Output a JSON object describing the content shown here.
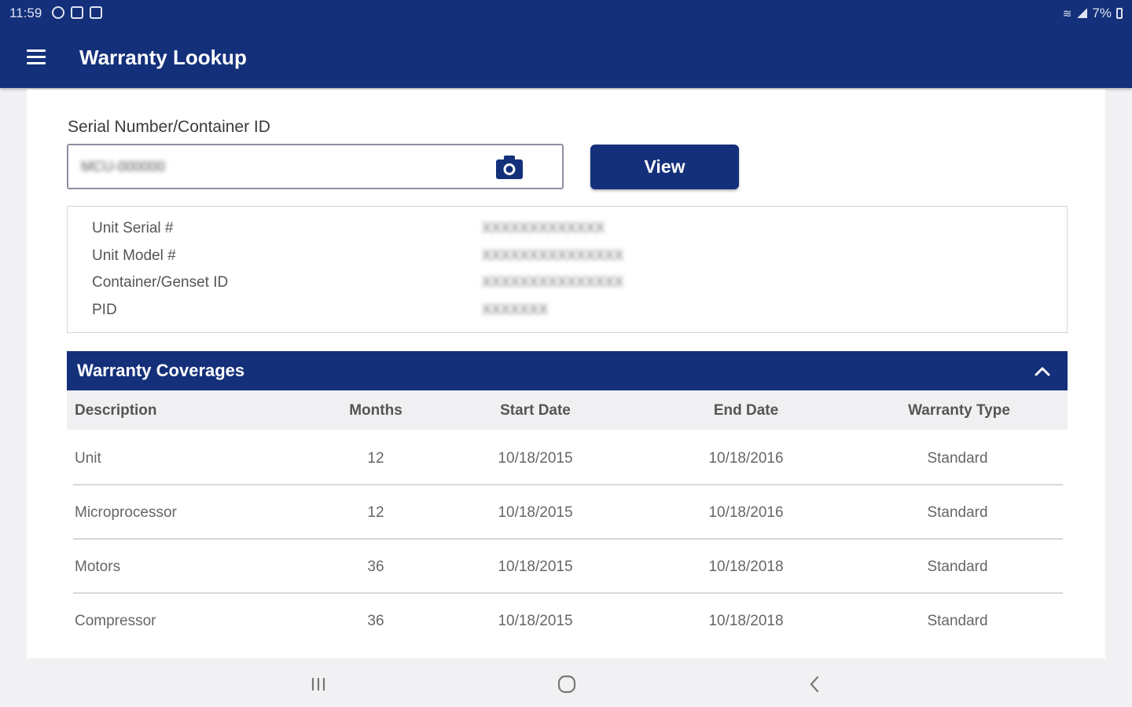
{
  "status_bar": {
    "time": "11:59",
    "battery": "7%",
    "icons": [
      "app-notification-icon",
      "image-icon",
      "calendar-icon",
      "wifi-icon",
      "signal-icon",
      "battery-icon"
    ]
  },
  "app_bar": {
    "title": "Warranty Lookup",
    "menu_icon": "hamburger-menu-icon"
  },
  "search": {
    "label": "Serial Number/Container ID",
    "value": "MCU-000000",
    "camera_icon": "camera-icon",
    "view_label": "View"
  },
  "unit_info": [
    {
      "label": "Unit Serial #",
      "value": "XXXXXXXXXXXXX"
    },
    {
      "label": "Unit Model #",
      "value": "XXXXXXXXXXXXXXX"
    },
    {
      "label": "Container/Genset ID",
      "value": "XXXXXXXXXXXXXXX"
    },
    {
      "label": "PID",
      "value": "XXXXXXX"
    }
  ],
  "coverages": {
    "title": "Warranty Coverages",
    "toggle_icon": "chevron-up-icon",
    "columns": [
      "Description",
      "Months",
      "Start Date",
      "End Date",
      "Warranty Type"
    ],
    "rows": [
      {
        "description": "Unit",
        "months": "12",
        "start": "10/18/2015",
        "end": "10/18/2016",
        "type": "Standard"
      },
      {
        "description": "Microprocessor",
        "months": "12",
        "start": "10/18/2015",
        "end": "10/18/2016",
        "type": "Standard"
      },
      {
        "description": "Motors",
        "months": "36",
        "start": "10/18/2015",
        "end": "10/18/2018",
        "type": "Standard"
      },
      {
        "description": "Compressor",
        "months": "36",
        "start": "10/18/2015",
        "end": "10/18/2018",
        "type": "Standard"
      }
    ]
  },
  "nav_bar": {
    "buttons": [
      "recent-apps-icon",
      "home-icon",
      "back-icon"
    ]
  },
  "colors": {
    "primary": "#14307a",
    "background": "#f1f1f3",
    "card": "#ffffff",
    "text": "#555555"
  }
}
